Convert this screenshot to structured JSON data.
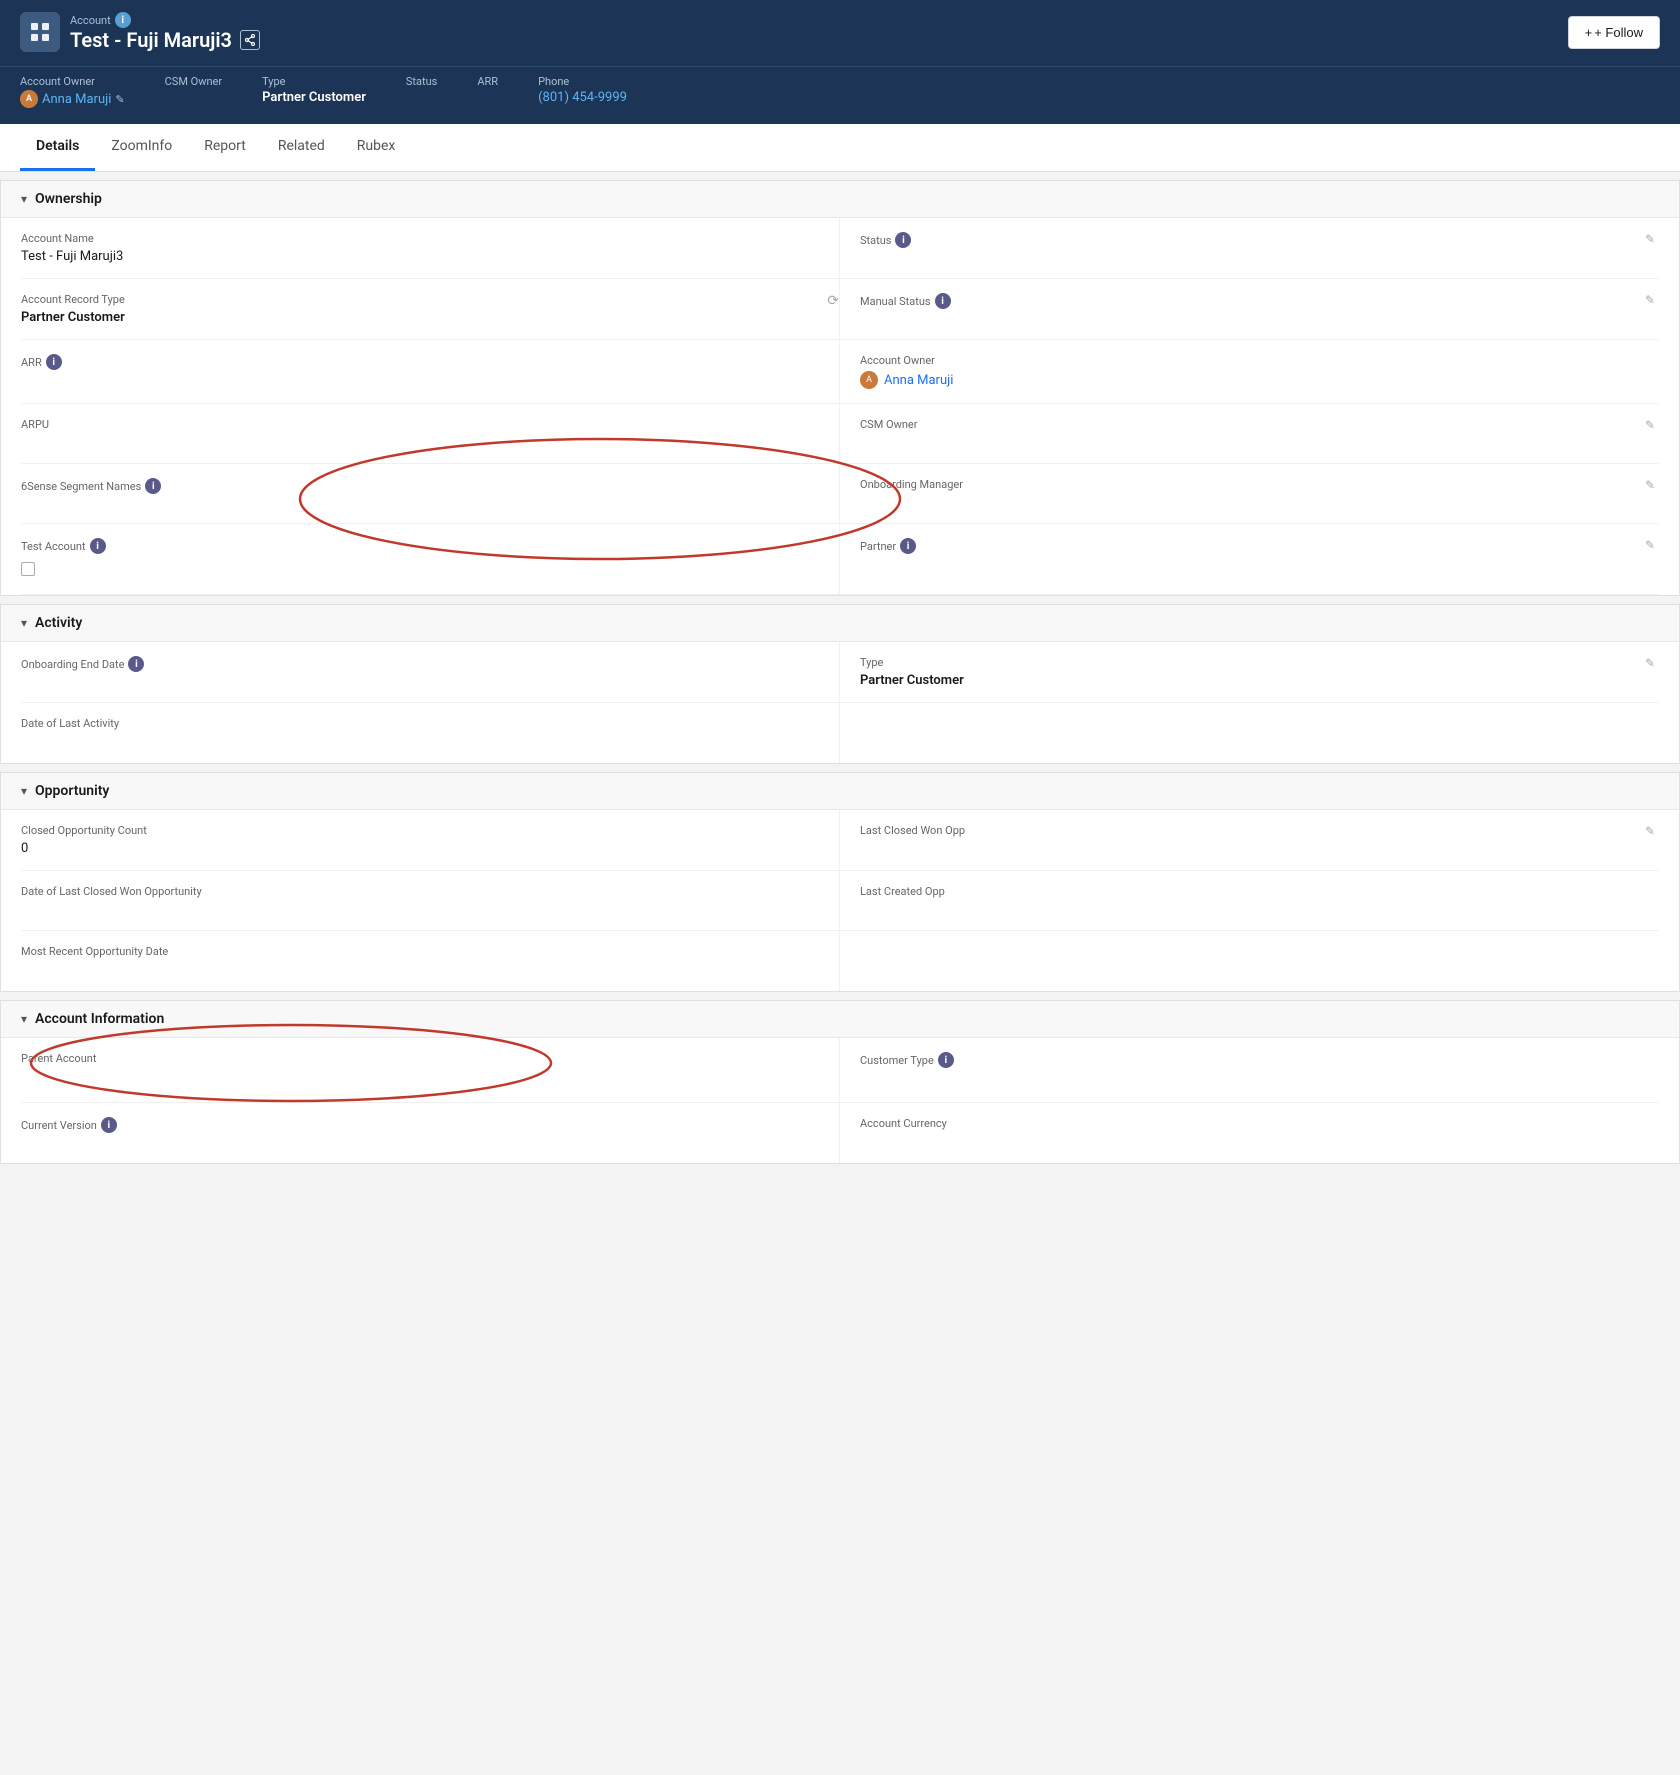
{
  "header": {
    "record_type_label": "Account",
    "name": "Test - Fuji Maruji3",
    "follow_label": "+ Follow"
  },
  "meta": {
    "account_owner_label": "Account Owner",
    "account_owner_value": "Anna Maruji",
    "csm_owner_label": "CSM Owner",
    "csm_owner_value": "",
    "type_label": "Type",
    "type_value": "Partner Customer",
    "status_label": "Status",
    "status_value": "",
    "arr_label": "ARR",
    "arr_value": "",
    "phone_label": "Phone",
    "phone_value": "(801) 454-9999"
  },
  "tabs": {
    "items": [
      {
        "label": "Details",
        "active": true
      },
      {
        "label": "ZoomInfo",
        "active": false
      },
      {
        "label": "Report",
        "active": false
      },
      {
        "label": "Related",
        "active": false
      },
      {
        "label": "Rubex",
        "active": false
      }
    ]
  },
  "sections": {
    "ownership": {
      "title": "Ownership",
      "fields": [
        {
          "label": "Account Name",
          "value": "Test - Fuji Maruji3",
          "type": "text",
          "side": "left"
        },
        {
          "label": "Status",
          "value": "",
          "type": "text",
          "side": "right",
          "has_info": true
        },
        {
          "label": "Account Record Type",
          "value": "Partner Customer",
          "type": "text",
          "side": "left"
        },
        {
          "label": "Manual Status",
          "value": "",
          "type": "text",
          "side": "right",
          "has_info": true
        },
        {
          "label": "ARR",
          "value": "",
          "type": "text",
          "side": "left",
          "has_info": true
        },
        {
          "label": "Account Owner",
          "value": "Anna Maruji",
          "type": "link",
          "side": "right"
        },
        {
          "label": "ARPU",
          "value": "",
          "type": "text",
          "side": "left"
        },
        {
          "label": "CSM Owner",
          "value": "",
          "type": "text",
          "side": "right"
        },
        {
          "label": "6Sense Segment Names",
          "value": "",
          "type": "text",
          "side": "left",
          "has_info": true
        },
        {
          "label": "Onboarding Manager",
          "value": "",
          "type": "text",
          "side": "right"
        },
        {
          "label": "Test Account",
          "value": "checkbox",
          "type": "checkbox",
          "side": "left",
          "has_info": true
        },
        {
          "label": "Partner",
          "value": "",
          "type": "text",
          "side": "right",
          "has_info": true,
          "annotated": true
        }
      ]
    },
    "activity": {
      "title": "Activity",
      "fields": [
        {
          "label": "Onboarding End Date",
          "value": "",
          "type": "text",
          "side": "left",
          "has_info": true
        },
        {
          "label": "Type",
          "value": "Partner Customer",
          "type": "text",
          "side": "right"
        },
        {
          "label": "Date of Last Activity",
          "value": "",
          "type": "text",
          "side": "left"
        },
        {
          "label": "",
          "value": "",
          "type": "text",
          "side": "right"
        }
      ]
    },
    "opportunity": {
      "title": "Opportunity",
      "fields": [
        {
          "label": "Closed Opportunity Count",
          "value": "0",
          "type": "text",
          "side": "left"
        },
        {
          "label": "Last Closed Won Opp",
          "value": "",
          "type": "text",
          "side": "right"
        },
        {
          "label": "Date of Last Closed Won Opportunity",
          "value": "",
          "type": "text",
          "side": "left"
        },
        {
          "label": "Last Created Opp",
          "value": "",
          "type": "text",
          "side": "right"
        },
        {
          "label": "Most Recent Opportunity Date",
          "value": "",
          "type": "text",
          "side": "left"
        },
        {
          "label": "",
          "value": "",
          "type": "text",
          "side": "right"
        }
      ]
    },
    "account_information": {
      "title": "Account Information",
      "fields": [
        {
          "label": "Parent Account",
          "value": "",
          "type": "text",
          "side": "left",
          "annotated": true
        },
        {
          "label": "Customer Type",
          "value": "",
          "type": "text",
          "side": "right",
          "has_info": true
        },
        {
          "label": "Current Version",
          "value": "",
          "type": "text",
          "side": "left",
          "has_info": true
        },
        {
          "label": "Account Currency",
          "value": "",
          "type": "text",
          "side": "right"
        }
      ]
    }
  }
}
